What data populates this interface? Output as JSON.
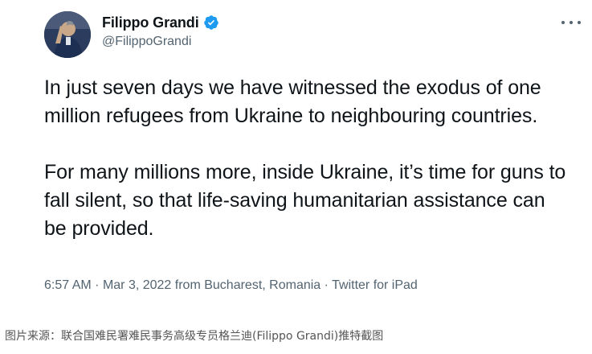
{
  "tweet": {
    "author_name": "Filippo Grandi",
    "author_handle": "@FilippoGrandi",
    "paragraphs": [
      "In just seven days we have witnessed the exodus of one million refugees from Ukraine to neighbouring countries.",
      "For many millions more, inside Ukraine, it’s time for guns to fall silent, so that life-saving humanitarian assistance can be provided."
    ],
    "time": "6:57 AM",
    "date": "Mar 3, 2022",
    "location": "from Bucharest, Romania",
    "source": "Twitter for iPad",
    "separator": "·"
  },
  "icons": {
    "verified": "verified-badge-icon",
    "more": "more-options-icon"
  },
  "colors": {
    "verified_blue": "#1d9bf0",
    "secondary_text": "#536471",
    "primary_text": "#0f1419"
  },
  "caption": "图片来源：联合国难民署难民事务高级专员格兰迪(Filippo Grandi)推特截图"
}
